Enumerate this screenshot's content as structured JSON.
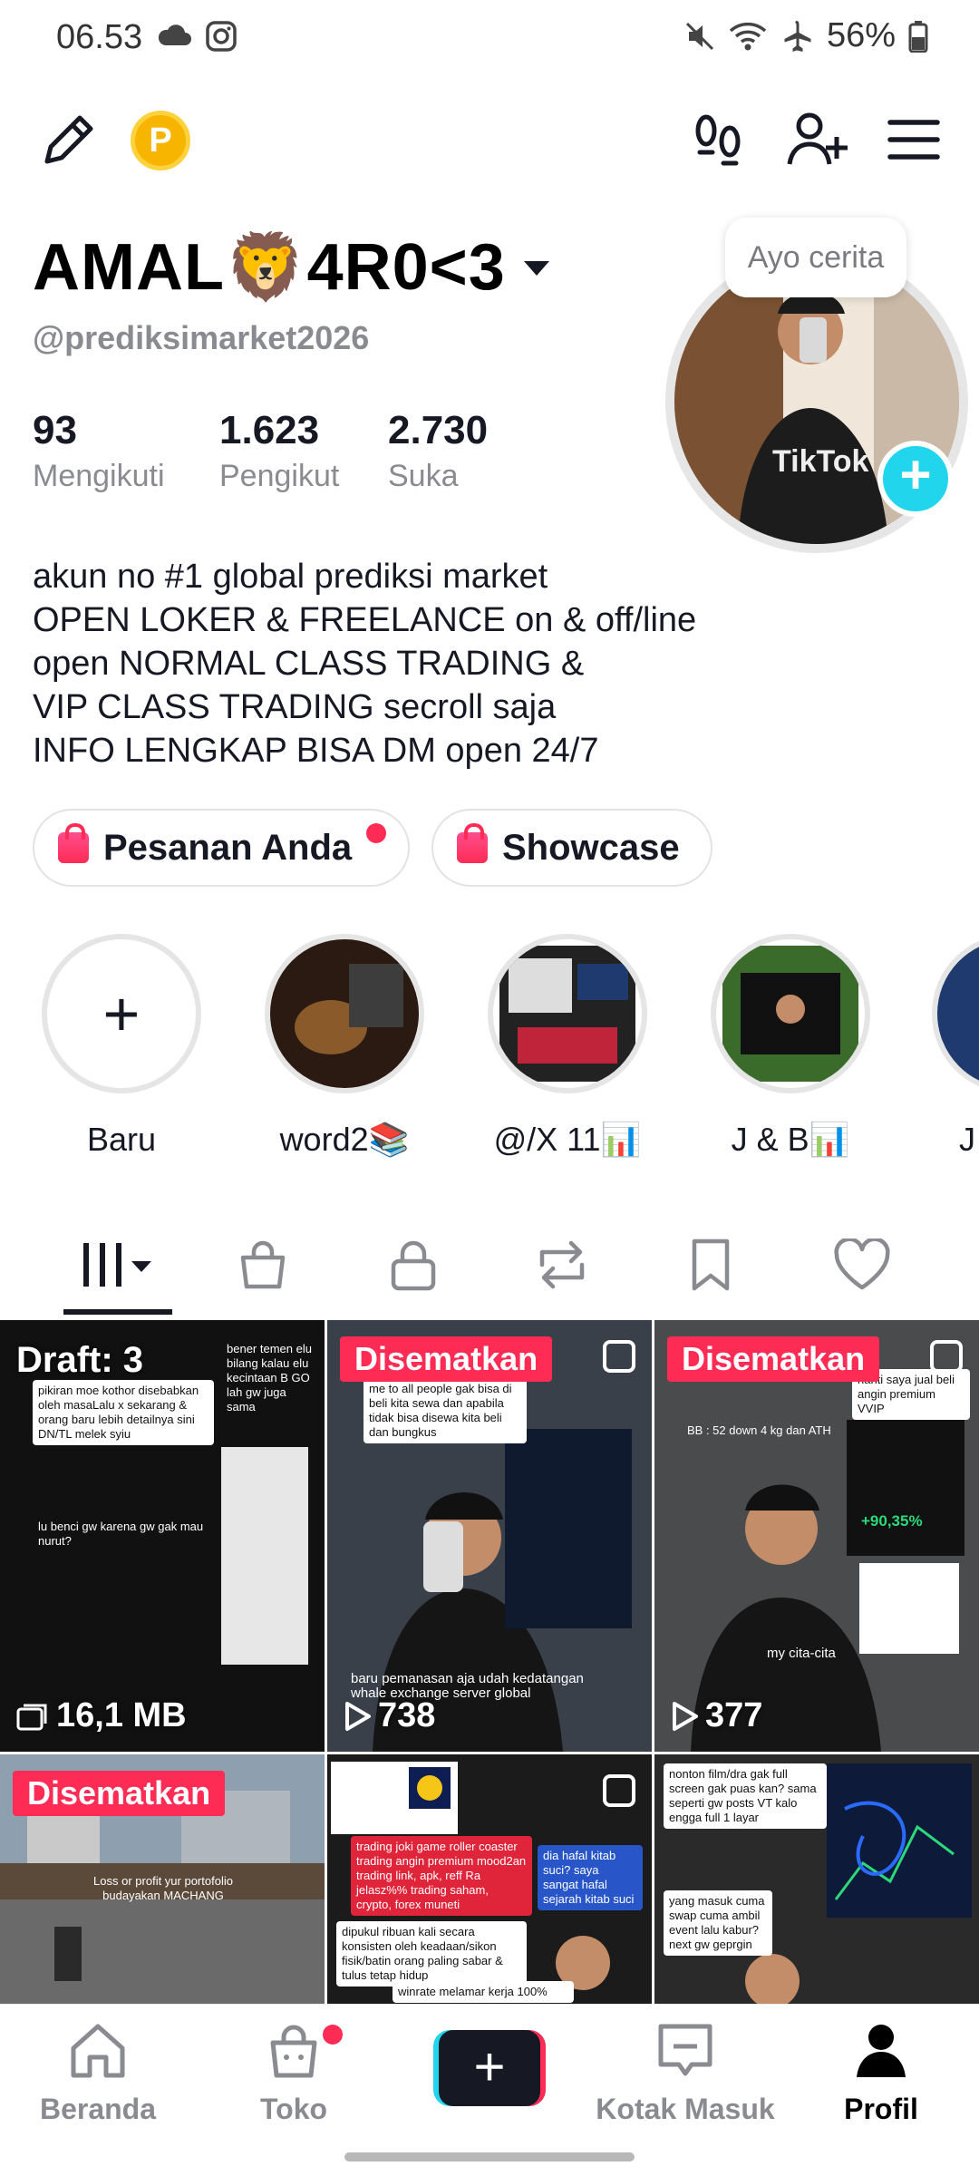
{
  "status_bar": {
    "time": "06.53",
    "battery": "56%"
  },
  "profile": {
    "display_name": "AMAL🦁4R0<3",
    "handle": "@prediksimarket2026",
    "story_tooltip": "Ayo cerita",
    "stats": [
      {
        "value": "93",
        "label": "Mengikuti"
      },
      {
        "value": "1.623",
        "label": "Pengikut"
      },
      {
        "value": "2.730",
        "label": "Suka"
      }
    ],
    "bio": "akun no #1 global prediksi market\nOPEN LOKER & FREELANCE on & off/line\nopen NORMAL CLASS TRADING &\nVIP CLASS TRADING secroll saja\nINFO LENGKAP BISA DM open 24/7",
    "buttons": {
      "orders": "Pesanan Anda",
      "showcase": "Showcase"
    },
    "coin_letter": "P"
  },
  "highlights": [
    {
      "label": "Baru"
    },
    {
      "label": "word2📚"
    },
    {
      "label": "@/X 11📊"
    },
    {
      "label": "J & B📊"
    },
    {
      "label": "J"
    }
  ],
  "grid": {
    "pinned_label": "Disematkan",
    "draft_label": "Draft: 3",
    "items": [
      {
        "badge": "draft",
        "meta": "16,1 MB"
      },
      {
        "badge": "pinned",
        "views": "738"
      },
      {
        "badge": "pinned",
        "views": "377"
      },
      {
        "badge": "pinned"
      },
      {
        "badge": "none"
      },
      {
        "badge": "none"
      }
    ],
    "snippets": {
      "c1a": "pikiran moe kothor disebabkan oleh masaLalu x sekarang & orang baru lebih detailnya sini DN/TL melek syiu",
      "c1b": "bener temen elu bilang kalau elu kecintaan B GO lah gw juga sama",
      "c1c": "lu benci gw karena gw gak mau nurut?",
      "c2a": "me to all people gak bisa di beli kita sewa dan apabila tidak bisa disewa kita beli dan bungkus",
      "c2b": "baru pemanasan aja udah kedatangan whale exchange server global",
      "c3a": "BB : 52 down 4 kg dan ATH",
      "c3b": "nanti saya jual beli angin premium VVIP",
      "c3c": "my cita-cita",
      "c3d": "+90,35%",
      "c4a": "Loss or profit yur portofolio budayakan MACHANG",
      "c5a": "trading joki game roller coaster trading angin premium mood2an trading link, apk, reff Ra jelasz%% trading saham, crypto, forex muneti",
      "c5b": "dia hafal kitab suci? saya sangat hafal sejarah kitab suci",
      "c5c": "dipukul ribuan kali secara konsisten oleh keadaan/sikon fisik/batin orang paling sabar & tulus tetap hidup",
      "c5d": "winrate melamar kerja 100%",
      "c6a": "nonton film/dra gak full screen gak puas kan? sama seperti gw posts VT kalo engga full 1 layar",
      "c6b": "yang masuk cuma swap cuma ambil event lalu kabur? next gw geprgin"
    }
  },
  "nav": {
    "home": "Beranda",
    "shop": "Toko",
    "inbox": "Kotak Masuk",
    "profile": "Profil"
  },
  "colors": {
    "accent": "#fe2c55",
    "cyan": "#20d5ec",
    "coin": "#f7b500"
  }
}
